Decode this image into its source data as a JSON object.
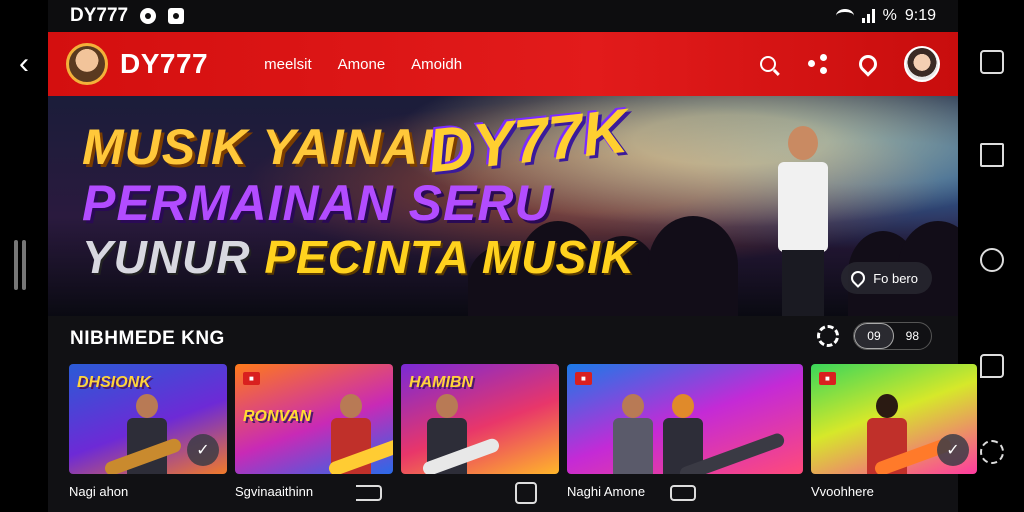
{
  "status_bar": {
    "app_name": "DY777",
    "battery": "%",
    "time": "9:19"
  },
  "header": {
    "brand": "DY777",
    "nav": [
      "meelsit",
      "Amone",
      "Amoidh"
    ]
  },
  "hero": {
    "line1": "MUSIK YAINAN",
    "brand_art": "DY77K",
    "line2": "PERMAINAN SERU",
    "line3_a": "YUNUR",
    "line3_b": "PECINTA MUSIK",
    "location_label": "Fo bero"
  },
  "section": {
    "title": "NIBHMEDE KNG",
    "toggle": [
      "09",
      "98"
    ]
  },
  "cards": [
    {
      "art": "DHSIONK",
      "badge": "",
      "label": "Nagi ahon"
    },
    {
      "art": "RONVAN",
      "badge": "",
      "label": "Sgvinaaithinn"
    },
    {
      "art": "HAMIBN",
      "badge": "",
      "label": ""
    },
    {
      "art": "",
      "badge": "",
      "label": "Naghi Amone"
    },
    {
      "art": "",
      "badge": "",
      "label": "Vvoohhere"
    }
  ],
  "colors": {
    "header_red": "#e21b1b",
    "accent_gold": "#ffc83a",
    "accent_purple": "#b24cff"
  }
}
